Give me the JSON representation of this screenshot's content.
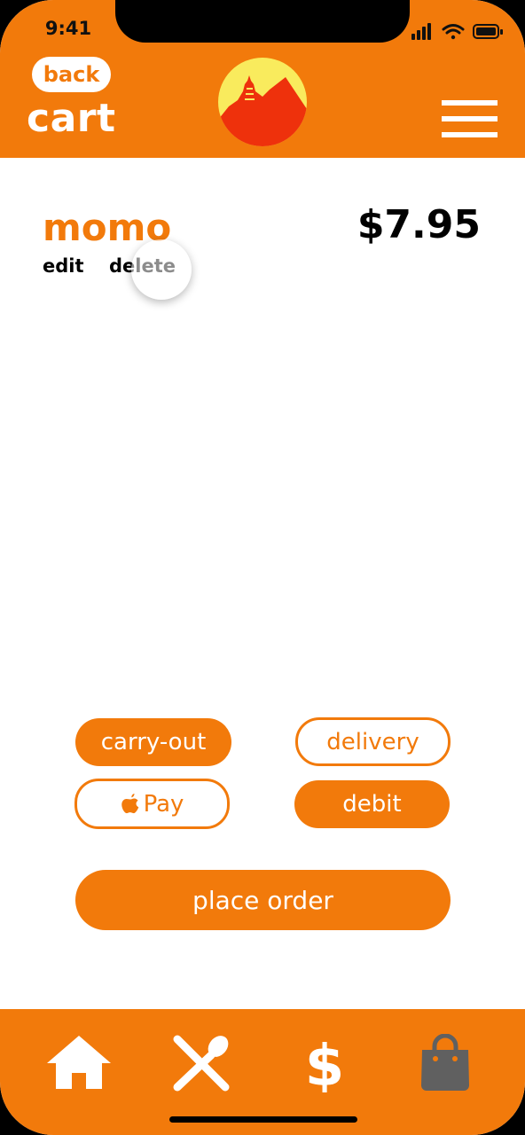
{
  "status_bar": {
    "time": "9:41"
  },
  "header": {
    "back_label": "back",
    "title": "cart"
  },
  "cart": {
    "items": [
      {
        "name": "momo",
        "price": "$7.95",
        "edit_label": "edit",
        "delete_label": "delete"
      }
    ]
  },
  "order_options": {
    "carry_out": "carry-out",
    "delivery": "delivery",
    "apple_pay": "Pay",
    "debit": "debit"
  },
  "place_order_label": "place order",
  "tabbar": {
    "items": [
      {
        "icon": "home-icon",
        "active": false
      },
      {
        "icon": "utensils-icon",
        "active": false
      },
      {
        "icon": "dollar-icon",
        "active": false
      },
      {
        "icon": "shopping-bag-icon",
        "active": true
      }
    ]
  },
  "colors": {
    "accent": "#F27A0B",
    "logo_sun": "#F9EB5D",
    "logo_mountain": "#EE310C",
    "tab_active": "#606060"
  }
}
